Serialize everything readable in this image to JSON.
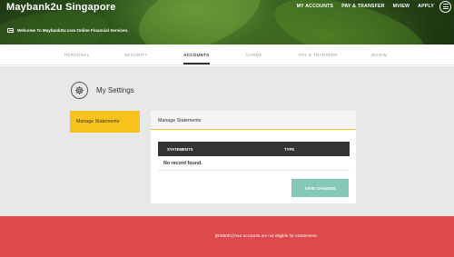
{
  "header": {
    "brand": "Maybank2u Singapore",
    "welcome": "Welcome To Maybank2U.com Online Financial Services.",
    "nav": [
      "MY ACCOUNTS",
      "PAY & TRANSFER",
      "MVIEW",
      "APPLY"
    ],
    "menu_icon": "hamburger-menu-icon"
  },
  "tabs": [
    "PERSONAL",
    "SECURITY",
    "ACCOUNTS",
    "CARDS",
    "PAY & TRANSFER",
    "MVIEW"
  ],
  "active_tab": "ACCOUNTS",
  "settings": {
    "title": "My Settings",
    "icon": "gear-icon"
  },
  "sidebar": {
    "items": [
      {
        "label": "Manage Statements",
        "active": true
      }
    ]
  },
  "panel": {
    "title": "Manage Statements",
    "columns": [
      "STATEMENTS",
      "TYPE"
    ],
    "empty_message": "No record found.",
    "save_label": "SAVE CHANGES"
  },
  "error": {
    "message": "[BIS5001]Your accounts are not eligible for eStatement."
  },
  "colors": {
    "accent": "#f8c21c",
    "table_header": "#333333",
    "save_button": "#86c8b6",
    "error_bar": "#dc4a4b"
  }
}
